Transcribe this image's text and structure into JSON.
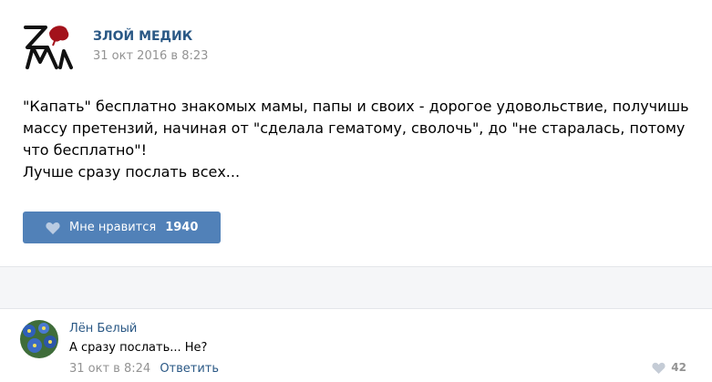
{
  "post": {
    "author": "ЗЛОЙ МЕДИК",
    "date": "31 окт 2016 в 8:23",
    "text_lines": [
      "\"Капать\" бесплатно знакомых мамы, папы и своих - дорогое удовольствие, получишь массу претензий, начиная от \"сделала гематому, сволочь\", до \"не старалась, потому что бесплатно\"!",
      "Лучше сразу послать всех..."
    ],
    "like_label": "Мне нравится",
    "like_count": "1940",
    "avatar_icon": "zm-logo-icon"
  },
  "comment": {
    "author": "Лён Белый",
    "text": "А сразу послать... Не?",
    "date": "31 окт в 8:24",
    "reply_label": "Ответить",
    "like_count": "42",
    "avatar_icon": "flower-avatar-icon"
  },
  "colors": {
    "link": "#2a5885",
    "like_button": "#5181b8",
    "meta": "#939393",
    "divider_bg": "#f5f6f8"
  }
}
